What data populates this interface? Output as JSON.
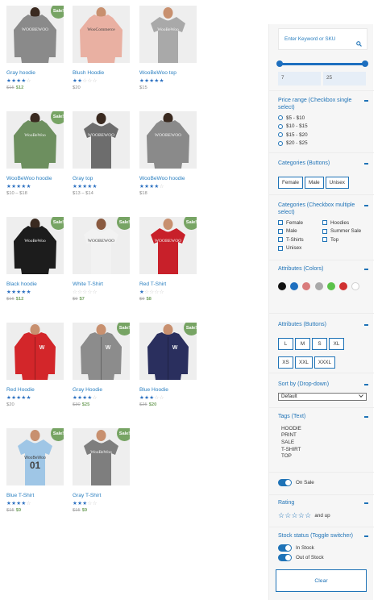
{
  "products": [
    {
      "name": "Gray hoodie",
      "stars": 4,
      "old_price": "$15",
      "price": "$12",
      "sale": true,
      "garment": "hoodie",
      "color": "#8a8a8a",
      "print": "WOOBEWOO",
      "model": "#3a2a20"
    },
    {
      "name": "Blush Hoodie",
      "stars": 2,
      "old_price": "",
      "price": "$20",
      "sale": false,
      "garment": "hoodie",
      "color": "#e9b0a2",
      "print": "WooCommerce",
      "model": "#c8906f"
    },
    {
      "name": "WooBeWoo top",
      "stars": 5,
      "old_price": "",
      "price": "$15",
      "sale": false,
      "garment": "tee",
      "color": "#a9a9a9",
      "print": "WooBeWoo",
      "model": "#c8906f"
    },
    {
      "name": "WooBeWoo hoodie",
      "stars": 5,
      "old_price": "",
      "price": "$10 – $18",
      "sale": true,
      "garment": "hoodie",
      "color": "#6d8f5f",
      "print": "WooBeWoo",
      "model": "#3a2a20"
    },
    {
      "name": "Gray top",
      "stars": 5,
      "old_price": "",
      "price": "$13 – $14",
      "sale": false,
      "garment": "tee",
      "color": "#6d6d6d",
      "print": "WOOBEWOO",
      "model": "#3a2a20"
    },
    {
      "name": "WooBeWoo hoodie",
      "stars": 4,
      "old_price": "",
      "price": "$18",
      "sale": false,
      "garment": "hoodie",
      "color": "#8a8a8a",
      "print": "WOOBEWOO",
      "model": "#3a2a20"
    },
    {
      "name": "Black hoodie",
      "stars": 5,
      "old_price": "$16",
      "price": "$12",
      "sale": true,
      "garment": "hoodie",
      "color": "#1c1c1c",
      "print": "WooBeWoo",
      "model": "#3a2a20"
    },
    {
      "name": "White T-Shirt",
      "stars": 0,
      "old_price": "$9",
      "price": "$7",
      "sale": true,
      "garment": "tee",
      "color": "#f2f2f2",
      "print": "WOOBEWOO",
      "model": "#8a5a40"
    },
    {
      "name": "Red T-Shirt",
      "stars": 1,
      "old_price": "$9",
      "price": "$8",
      "sale": true,
      "garment": "tee",
      "color": "#c8202a",
      "print": "WOOBEWOO",
      "model": "#c8906f"
    },
    {
      "name": "Red Hoodie",
      "stars": 5,
      "old_price": "",
      "price": "$20",
      "sale": false,
      "garment": "zip",
      "color": "#d3262a",
      "print": "W",
      "model": "#c8906f"
    },
    {
      "name": "Gray Hoodie",
      "stars": 4,
      "old_price": "$30",
      "price": "$25",
      "sale": true,
      "garment": "zip",
      "color": "#8c8c8c",
      "print": "W",
      "model": "#c8906f"
    },
    {
      "name": "Blue Hoodie",
      "stars": 3,
      "old_price": "$25",
      "price": "$20",
      "sale": true,
      "garment": "zip",
      "color": "#2a2f5e",
      "print": "W",
      "model": "#c8906f"
    },
    {
      "name": "Blue T-Shirt",
      "stars": 4,
      "old_price": "$15",
      "price": "$9",
      "sale": true,
      "garment": "tee",
      "color": "#9fc6e6",
      "print": "01",
      "model": "#c8906f"
    },
    {
      "name": "Gray T-Shirt",
      "stars": 3,
      "old_price": "$15",
      "price": "$9",
      "sale": true,
      "garment": "tee",
      "color": "#7e7e7e",
      "print": "WooBeWoo",
      "model": "#c8906f"
    }
  ],
  "sale_badge": "Sale!",
  "sidebar": {
    "search_placeholder": "Enter Keyword or SKU",
    "search_icon": "search-icon",
    "range_min": "7",
    "range_max": "25",
    "price_title": "Price range (Checkbox single select)",
    "price_options": [
      "$5 - $10",
      "$10 - $15",
      "$15 - $20",
      "$20 - $25"
    ],
    "cat_buttons_title": "Categories (Buttons)",
    "cat_buttons": [
      "Female",
      "Male",
      "Unisex"
    ],
    "cat_multi_title": "Categories (Checkbox multiple select)",
    "cat_multi_left": [
      "Female",
      "Male",
      "T-Shirts",
      "Unisex"
    ],
    "cat_multi_right": [
      "Hoodies",
      "Summer Sale",
      "Top"
    ],
    "colors_title": "Attributes (Colors)",
    "colors": [
      "#111111",
      "#1e6fbf",
      "#d97b7b",
      "#a9a9a9",
      "#5bc24a",
      "#d03030",
      "#ffffff"
    ],
    "attr_buttons_title": "Attributes (Buttons)",
    "sizes": [
      "L",
      "M",
      "S",
      "XL",
      "XS",
      "XXL",
      "XXXL"
    ],
    "sort_title": "Sort by (Drop-down)",
    "sort_value": "Default",
    "tags_title": "Tags (Text)",
    "tags": [
      "HOODIE",
      "PRINT",
      "SALE",
      "T-SHIRT",
      "TOP"
    ],
    "on_sale_label": "On Sale",
    "rating_title": "Rating",
    "rating_suffix": "and up",
    "stock_title": "Stock status (Toggle switcher)",
    "stock_options": [
      "In Stock",
      "Out of Stock"
    ],
    "clear_label": "Clear",
    "accent": "#1f73b7"
  }
}
